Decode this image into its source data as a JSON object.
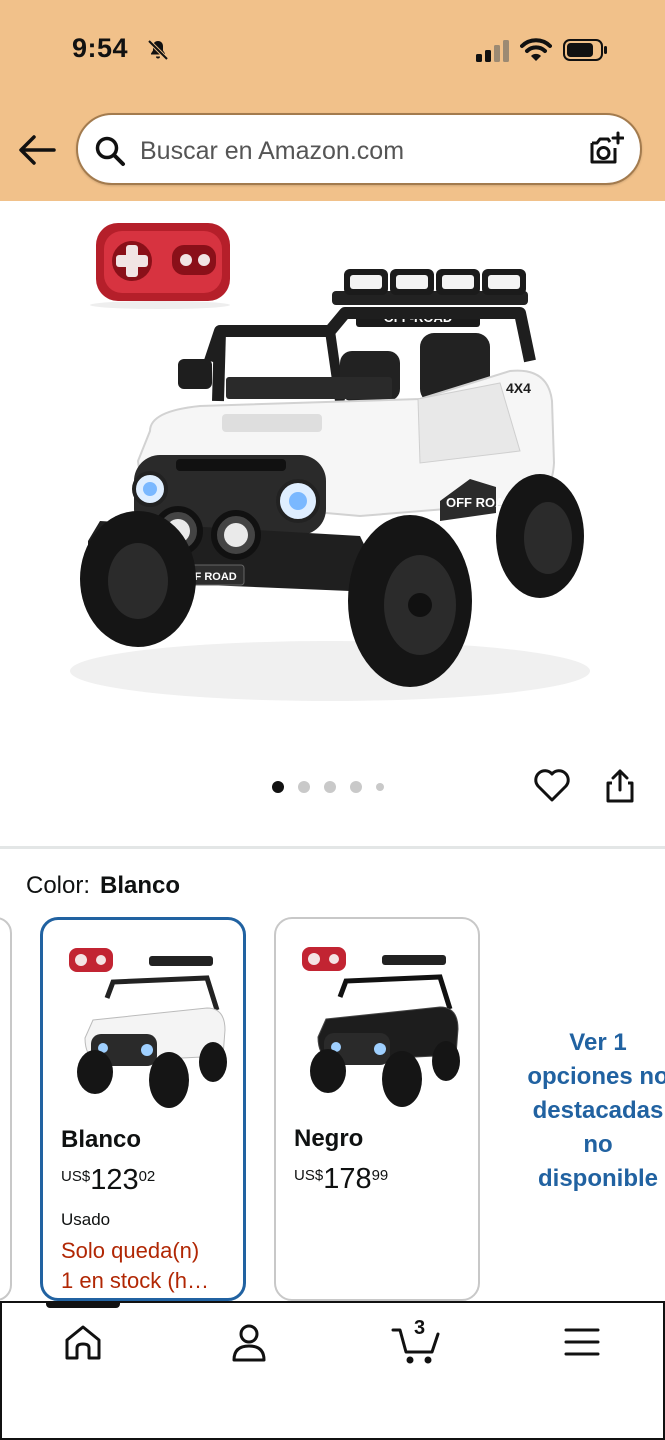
{
  "status_bar": {
    "time": "9:54",
    "icons": [
      "bell-slash-icon",
      "signal-icon",
      "wifi-icon",
      "battery-icon"
    ]
  },
  "search": {
    "placeholder": "Buscar en Amazon.com",
    "icons": [
      "back-arrow-icon",
      "search-icon",
      "camera-icon"
    ]
  },
  "gallery": {
    "image_count": 5,
    "active_index": 0,
    "product_image_text": [
      "OFF-ROAD",
      "4X4",
      "OFF ROAD",
      "OFF ROAD"
    ]
  },
  "actions": {
    "icons": [
      "heart-icon",
      "share-icon"
    ]
  },
  "color": {
    "label": "Color:",
    "selected": "Blanco"
  },
  "swatches": [
    {
      "name": "Blanco",
      "currency": "US$",
      "price_whole": "123",
      "price_fraction": "02",
      "condition": "Usado",
      "stock_line1": "Solo queda(n)",
      "stock_line2": "1 en stock (h…",
      "selected": true,
      "car_color": "#f4f4f4"
    },
    {
      "name": "Negro",
      "currency": "US$",
      "price_whole": "178",
      "price_fraction": "99",
      "selected": false,
      "car_color": "#1d1d1d"
    }
  ],
  "more_options": {
    "line1": "Ver 1",
    "line2": "opciones no",
    "line3": "destacadas",
    "line4": "no",
    "line5": "disponible"
  },
  "bottom_nav": {
    "cart_count": "3",
    "items": [
      "home-icon",
      "account-icon",
      "cart-icon",
      "menu-icon"
    ]
  },
  "colors": {
    "header_bg": "#f1c18a",
    "accent_blue": "#2162a1",
    "stock_red": "#b12704"
  }
}
